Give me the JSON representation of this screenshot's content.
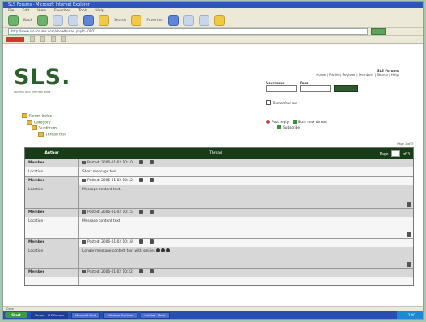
{
  "window": {
    "title": "SLS Forums - Microsoft Internet Explorer"
  },
  "menu": [
    "File",
    "Edit",
    "View",
    "Favorites",
    "Tools",
    "Help"
  ],
  "toolbar": {
    "back": "Back",
    "search": "Search",
    "favorites": "Favorites"
  },
  "address": {
    "value": "http://www.sls-forums.com/showthread.php?t=0001"
  },
  "site": {
    "logo": "SLS.",
    "tagline": "Forums and member area"
  },
  "login": {
    "title": "SLS Forums",
    "subtitle": "Home | Profile | Register | Members | Search | Help",
    "username_label": "Username",
    "password_label": "Pass",
    "remember": "Remember me"
  },
  "breadcrumb": [
    "Forum Index",
    "Category",
    "Subforum",
    "Thread title"
  ],
  "actions": {
    "reply": "Post reply",
    "new_thread": "Start new thread",
    "subscribe": "Subscribe"
  },
  "table": {
    "author_header": "Author",
    "subject_header": "Thread",
    "pages_label": "Page",
    "pages_of": "of 3",
    "page_current": "1",
    "page_label_top": "Page 1 of 3"
  },
  "posts": [
    {
      "author": "Member",
      "posted": "Posted: 2006-01-02 10:10",
      "location": "Location",
      "message": "Short message text.",
      "shade": "white"
    },
    {
      "author": "Member",
      "posted": "Posted: 2006-01-02 10:12",
      "location": "Location",
      "message": "Message content text.",
      "shade": "grey"
    },
    {
      "author": "Member",
      "posted": "Posted: 2006-01-02 10:15",
      "location": "Location",
      "message": "Message content text",
      "shade": "white"
    },
    {
      "author": "Member",
      "posted": "Posted: 2006-01-02 10:18",
      "location": "Location",
      "message": "Longer message content text with smilies",
      "shade": "grey"
    },
    {
      "author": "Member",
      "posted": "Posted: 2006-01-02 10:22",
      "location": "",
      "message": "",
      "shade": "white"
    }
  ],
  "statusbar": {
    "text": "Done"
  },
  "taskbar": {
    "start": "Start",
    "tasks": [
      "Thread - SLS Forums",
      "Microsoft Word",
      "Windows Explorer",
      "Untitled - Paint"
    ],
    "clock": "12:00"
  }
}
